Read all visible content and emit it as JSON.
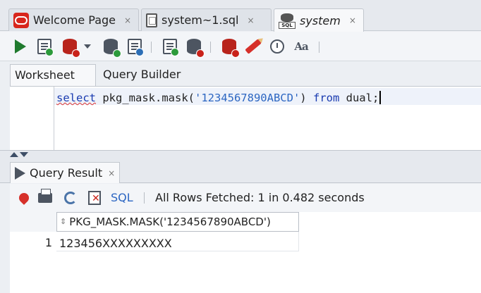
{
  "doc_tabs": [
    {
      "label": "Welcome Page",
      "icon": "oracle-icon",
      "close": "×"
    },
    {
      "label": "system~1.sql",
      "icon": "sql-file-icon",
      "close": "×"
    },
    {
      "label": "system",
      "icon": "sql-connection-icon",
      "close": "×",
      "icon_text": "SQL"
    }
  ],
  "worksheet": {
    "tabs": [
      "Worksheet",
      "Query Builder"
    ],
    "code": {
      "keyword_select": "select",
      "func": " pkg_mask.mask(",
      "arg": "'1234567890ABCD'",
      "close_paren": ")",
      "keyword_from": "from",
      "rest": " dual;"
    }
  },
  "result_panel": {
    "tab_label": "Query Result",
    "tab_close": "×",
    "sql_label": "SQL",
    "separator": "|",
    "status": "All Rows Fetched: 1 in 0.482 seconds",
    "column_header": "PKG_MASK.MASK('1234567890ABCD')",
    "sort_icon": "⇕",
    "rows": [
      {
        "num": "1",
        "value": "123456XXXXXXXXX"
      }
    ]
  },
  "colors": {
    "oracle_red": "#d8261c",
    "run_green": "#1f7a2e",
    "keyword_blue": "#1a3bb0",
    "string_blue": "#2c66c2",
    "link_blue": "#2c66c2"
  }
}
